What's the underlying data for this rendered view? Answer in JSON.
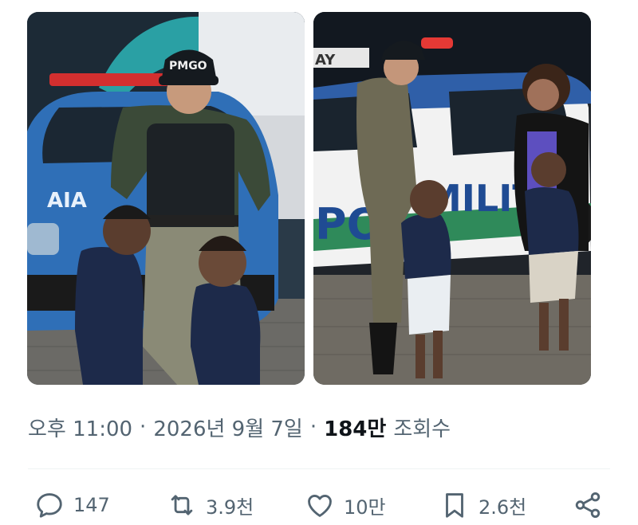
{
  "tweet": {
    "photos": [
      {
        "id": "left",
        "car_text": "AIA",
        "cap_text": "PMGO"
      },
      {
        "id": "right",
        "car_text": "PO",
        "car_text_2": "MILITA",
        "sign_text": "AY"
      }
    ],
    "meta": {
      "time": "오후 11:00",
      "separator": "·",
      "date": "2026년 9월 7일",
      "views_count": "184만",
      "views_label": "조회수"
    },
    "actions": {
      "reply_count": "147",
      "repost_count": "3.9천",
      "like_count": "10만",
      "bookmark_count": "2.6천"
    }
  },
  "colors": {
    "meta_text": "#536471",
    "emphasis_text": "#0f1419",
    "icon": "#536471",
    "divider": "#eff3f4"
  },
  "icons": [
    "reply-icon",
    "repost-icon",
    "like-icon",
    "bookmark-icon",
    "share-icon"
  ]
}
